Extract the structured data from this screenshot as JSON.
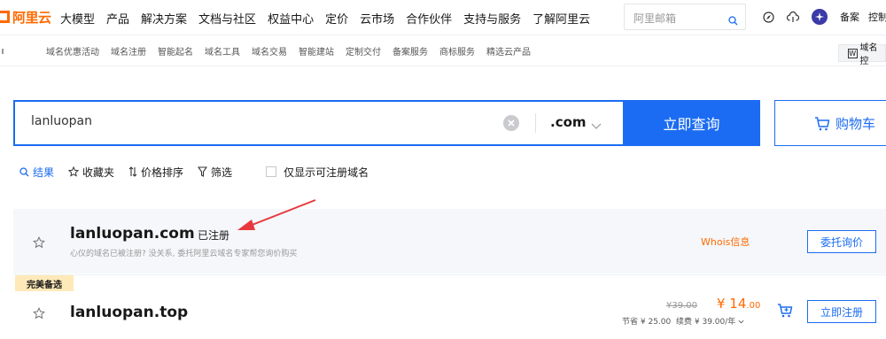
{
  "header": {
    "logo_text": "阿里云",
    "nav": [
      "大模型",
      "产品",
      "解决方案",
      "文档与社区",
      "权益中心",
      "定价",
      "云市场",
      "合作伙伴",
      "支持与服务",
      "了解阿里云"
    ],
    "mail_placeholder": "阿里邮箱",
    "beian": "备案",
    "console": "控制台"
  },
  "subnav": {
    "items": [
      "域名优惠活动",
      "域名注册",
      "智能起名",
      "域名工具",
      "域名交易",
      "智能建站",
      "定制交付",
      "备案服务",
      "商标服务",
      "精选云产品"
    ],
    "brand": "域名控"
  },
  "search": {
    "value": "lanluopan",
    "suffix": ".com",
    "query_label": "立即查询",
    "cart_label": "购物车"
  },
  "filters": {
    "results": "结果",
    "favorites": "收藏夹",
    "price_sort": "价格排序",
    "filter": "筛选",
    "only_available": "仅显示可注册域名"
  },
  "results": [
    {
      "domain": "lanluopan.com",
      "status": "已注册",
      "desc": "心仪的域名已被注册? 没关系, 委托阿里云域名专家帮您询价购买",
      "whois": "Whois信息",
      "action": "委托询价"
    },
    {
      "badge": "完美备选",
      "domain": "lanluopan.top",
      "old_price": "¥39.00",
      "new_price_int": "¥ 14",
      "new_price_dec": ".00",
      "save_label": "节省",
      "save_value": "¥ 25.00",
      "renew_label": "续费",
      "renew_value": "¥ 39.00/年",
      "action": "立即注册"
    }
  ],
  "colors": {
    "brand_orange": "#ff6a00",
    "primary_blue": "#1b6cf2",
    "annotation_red": "#e8383d"
  }
}
